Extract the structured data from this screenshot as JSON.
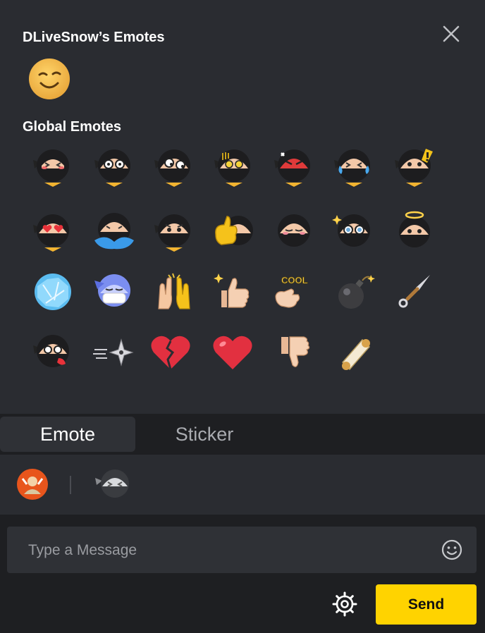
{
  "channel_section": {
    "title": "DLiveSnow’s Emotes"
  },
  "global_section": {
    "title": "Global Emotes"
  },
  "channel_emotes": [
    {
      "icon": "wink-smiley-icon"
    }
  ],
  "global_emotes": [
    {
      "icon": "ninja-blush-icon"
    },
    {
      "icon": "ninja-shocked-icon"
    },
    {
      "icon": "ninja-sideeye-icon"
    },
    {
      "icon": "ninja-dismay-icon"
    },
    {
      "icon": "ninja-angry-icon"
    },
    {
      "icon": "ninja-cry-laugh-icon"
    },
    {
      "icon": "ninja-alert-icon"
    },
    {
      "icon": "ninja-heart-eyes-icon"
    },
    {
      "icon": "ninja-crying-icon"
    },
    {
      "icon": "ninja-worried-icon"
    },
    {
      "icon": "ninja-thumbs-up-icon"
    },
    {
      "icon": "ninja-content-icon"
    },
    {
      "icon": "ninja-sparkle-eyes-icon"
    },
    {
      "icon": "ninja-angel-icon"
    },
    {
      "icon": "ninja-frozen-icon"
    },
    {
      "icon": "ninja-mask-icon"
    },
    {
      "icon": "high-five-icon"
    },
    {
      "icon": "thumbs-up-icon"
    },
    {
      "icon": "cool-hand-icon"
    },
    {
      "icon": "bomb-icon"
    },
    {
      "icon": "kunai-icon"
    },
    {
      "icon": "ninja-hurt-icon"
    },
    {
      "icon": "shuriken-icon"
    },
    {
      "icon": "broken-heart-icon"
    },
    {
      "icon": "heart-icon"
    },
    {
      "icon": "thumbs-down-icon"
    },
    {
      "icon": "scroll-icon"
    }
  ],
  "tabs": [
    {
      "label": "Emote",
      "active": true
    },
    {
      "label": "Sticker",
      "active": false
    }
  ],
  "packs": [
    {
      "icon": "channel-avatar-icon"
    },
    {
      "icon": "ninja-pack-icon"
    }
  ],
  "composer": {
    "placeholder": "Type a Message",
    "send_label": "Send"
  },
  "colors": {
    "accent": "#ffd300",
    "panel": "#2a2c31",
    "background": "#1e1f22"
  }
}
